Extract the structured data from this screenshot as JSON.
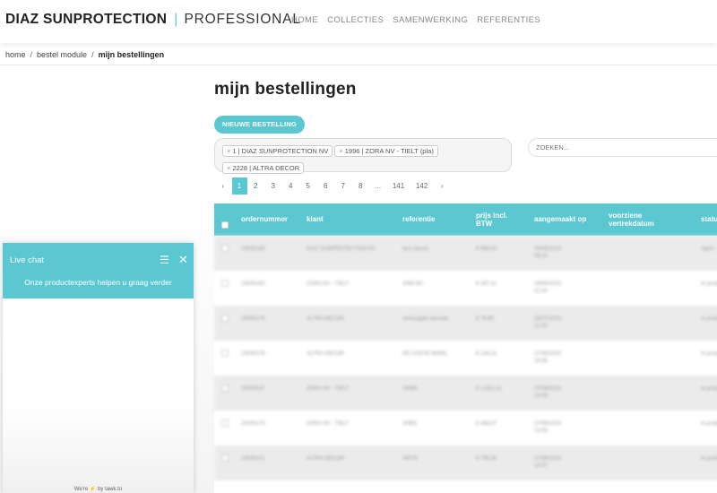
{
  "header": {
    "brand_bold": "DIAZ SUNPROTECTION",
    "brand_sep": "|",
    "brand_light": "PROFESSIONAL",
    "nav": [
      "HOME",
      "COLLECTIES",
      "SAMENWERKING",
      "REFERENTIES"
    ]
  },
  "breadcrumb": {
    "items": [
      "home",
      "bestel module"
    ],
    "separator": "/",
    "current": "mijn bestellingen"
  },
  "page": {
    "title": "mijn bestellingen",
    "new_order_label": "NIEUWE BESTELLING"
  },
  "filters": {
    "chips": [
      "1 | DIAZ SUNPROTECTION NV",
      "1996 | ZORA NV - TIELT (pla)",
      "2228 | ALTRA DECOR"
    ],
    "remove_icon": "×"
  },
  "search": {
    "placeholder": "ZOEKEN..."
  },
  "pagination": {
    "prev": "‹",
    "pages": [
      "1",
      "2",
      "3",
      "4",
      "5",
      "6",
      "7",
      "8",
      "...",
      "141",
      "142"
    ],
    "next": "›",
    "active_page": "1"
  },
  "table": {
    "columns": [
      "ordernummer",
      "klant",
      "referentie",
      "prijs incl. BTW",
      "aangemaakt op",
      "voorziene vertrekdatum",
      "status"
    ],
    "rows": [
      {
        "ordernummer": "23000189",
        "klant": "DIAZ SUNPROTECTION NV",
        "referentie": "test classic",
        "prijs": "€ 998,00",
        "aangemaakt": "03/08/2023 09:22",
        "vertrek": "",
        "status": "Open"
      },
      {
        "ordernummer": "23000183",
        "klant": "ZORA NV - TIELT",
        "referentie": "2085 BU",
        "prijs": "€ 187,11",
        "aangemaakt": "03/08/2023 11:24",
        "vertrek": "",
        "status": "In productie"
      },
      {
        "ordernummer": "23000176",
        "klant": "ALTRA DECOR",
        "referentie": "vertraagde verzoek",
        "prijs": "€ 78,90",
        "aangemaakt": "28/07/2023 11:04",
        "vertrek": "",
        "status": "In productie"
      },
      {
        "ordernummer": "23000178",
        "klant": "ALTRA DECOR",
        "referentie": "DE COSTE MARIL",
        "prijs": "€ 144,21",
        "aangemaakt": "27/06/2023 16:56",
        "vertrek": "",
        "status": "In productie"
      },
      {
        "ordernummer": "23000137",
        "klant": "ZORA NV - TIELT",
        "referentie": "20980",
        "prijs": "€ 1.822,14",
        "aangemaakt": "27/06/2023 13:09",
        "vertrek": "",
        "status": "In productie"
      },
      {
        "ordernummer": "23000175",
        "klant": "ZORA NV - TIELT",
        "referentie": "20981",
        "prijs": "€ 468,07",
        "aangemaakt": "27/06/2023 13:05",
        "vertrek": "",
        "status": "In productie"
      },
      {
        "ordernummer": "23000101",
        "klant": "ALTRA DECOR",
        "referentie": "20979",
        "prijs": "€ 795,46",
        "aangemaakt": "27/06/2023 10:07",
        "vertrek": "",
        "status": "In productie"
      }
    ]
  },
  "chat": {
    "title": "Live chat",
    "subtitle": "Onze productexperts helpen u graag verder",
    "footer": "We're ⚡ by tawk.to",
    "menu_icon": "hamburger-menu-icon",
    "close_icon": "close-icon"
  },
  "colors": {
    "accent": "#5bc8d1"
  }
}
